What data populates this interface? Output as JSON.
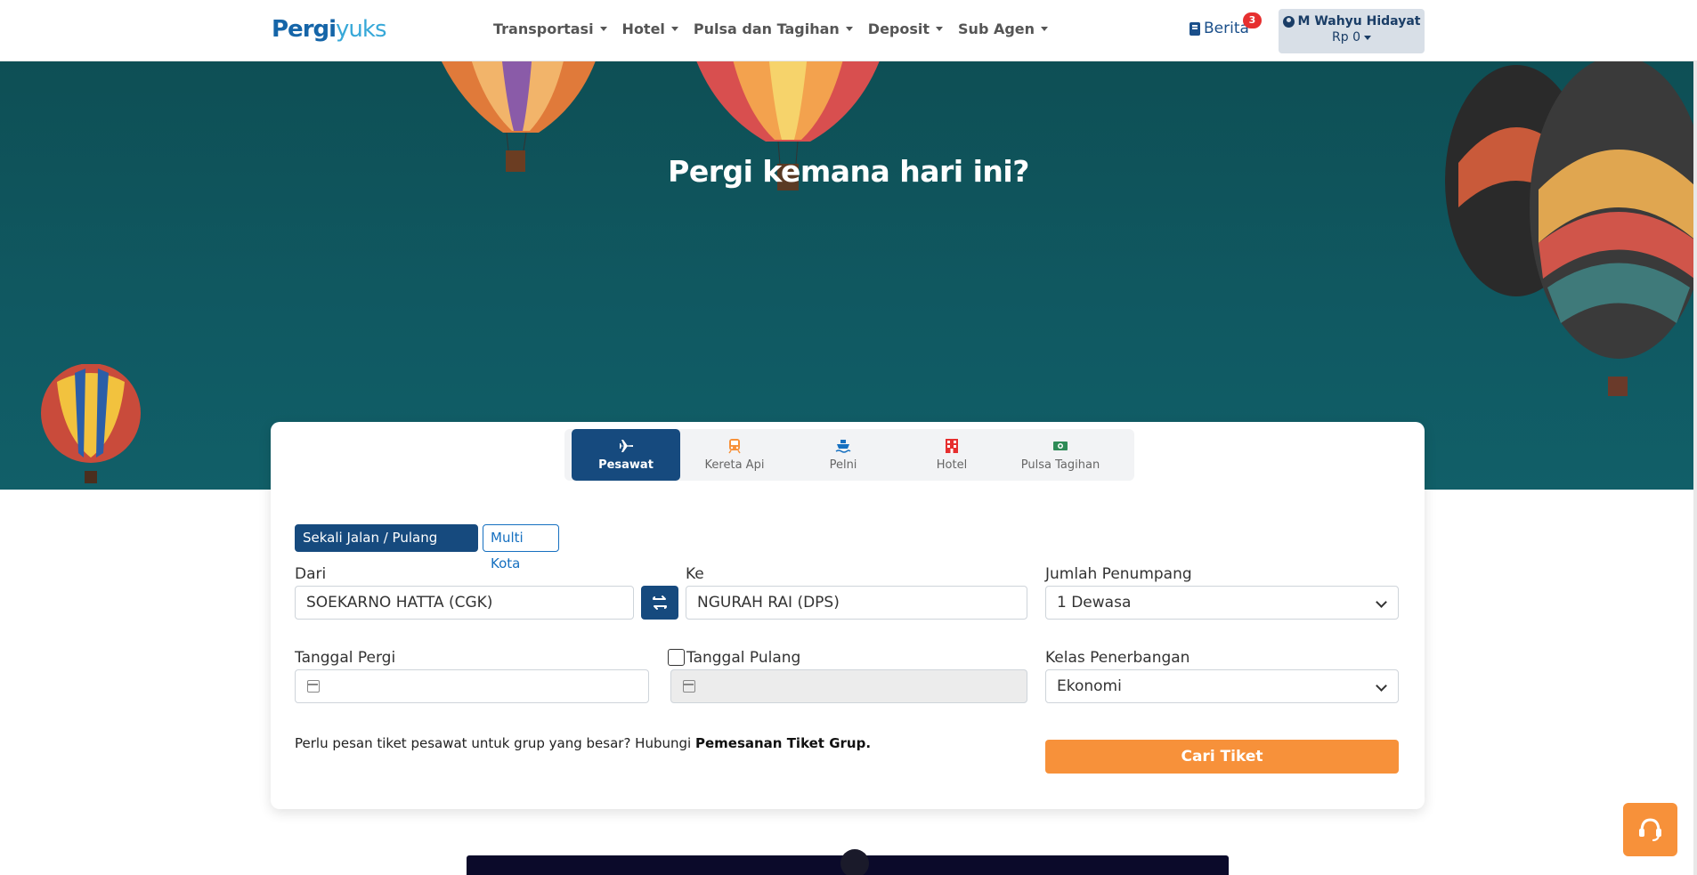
{
  "navbar": {
    "logo_part1": "Pergi",
    "logo_part2": "yuks",
    "menu": [
      {
        "label": "Transportasi"
      },
      {
        "label": "Hotel"
      },
      {
        "label": "Pulsa dan Tagihan"
      },
      {
        "label": "Deposit"
      },
      {
        "label": "Sub Agen"
      }
    ],
    "berita_label": "Berita",
    "berita_badge": "3",
    "user_name": "M Wahyu Hidayat",
    "user_balance": "Rp 0"
  },
  "hero": {
    "title": "Pergi kemana hari ini?"
  },
  "tabs": [
    {
      "label": "Pesawat",
      "icon": "plane-icon",
      "color": "#ffffff"
    },
    {
      "label": "Kereta Api",
      "icon": "train-icon",
      "color": "#f7913a"
    },
    {
      "label": "Pelni",
      "icon": "ship-icon",
      "color": "#1670c0"
    },
    {
      "label": "Hotel",
      "icon": "hotel-icon",
      "color": "#e62f2f"
    },
    {
      "label": "Pulsa Tagihan",
      "icon": "money-icon",
      "color": "#2e8b57"
    }
  ],
  "form": {
    "trip_oneway": "Sekali Jalan / Pulang Pergi",
    "trip_multi": "Multi Kota",
    "from_label": "Dari",
    "from_value": "SOEKARNO HATTA (CGK)",
    "to_label": "Ke",
    "to_value": "NGURAH RAI (DPS)",
    "passengers_label": "Jumlah Penumpang",
    "passengers_value": "1 Dewasa",
    "depart_label": "Tanggal Pergi",
    "return_label": "Tanggal Pulang",
    "class_label": "Kelas Penerbangan",
    "class_value": "Ekonomi",
    "info_text": "Perlu pesan tiket pesawat untuk grup yang besar? Hubungi ",
    "info_link": "Pemesanan Tiket Grup.",
    "search_button": "Cari Tiket"
  },
  "colors": {
    "primary": "#164a7e",
    "accent": "#f7913a",
    "hero_bg": "#0e4f55"
  }
}
